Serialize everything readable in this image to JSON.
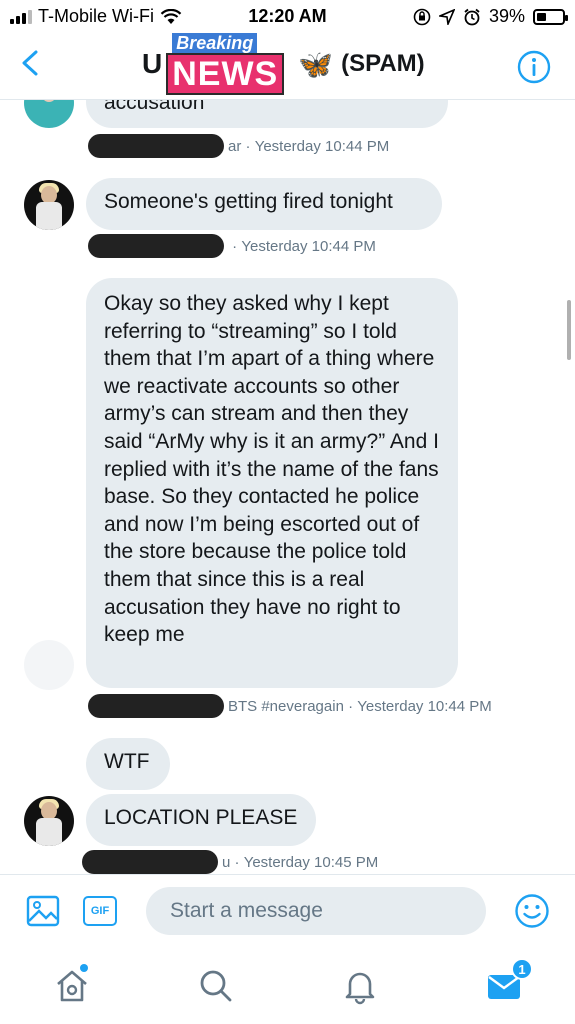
{
  "status_bar": {
    "carrier": "T-Mobile Wi-Fi",
    "time": "12:20 AM",
    "battery": "39%",
    "battery_level": 0.39
  },
  "header": {
    "title_lead": "U",
    "logo_top_text": "Breaking",
    "logo_main_text": "NEWS",
    "butterfly_glyph": "🦋",
    "title_tag": "(SPAM)",
    "back_icon": "chevron-left-icon",
    "info_icon": "info-icon"
  },
  "messages": [
    {
      "text": "accusation",
      "meta_name_tail": "ar",
      "meta_time": "Yesterday 10:44 PM"
    },
    {
      "text": "Someone's getting fired tonight",
      "meta_name_tail": "",
      "meta_time": "Yesterday 10:44 PM"
    },
    {
      "text": "Okay so they asked why I kept referring to “streaming” so I told them that I’m apart of a thing where we reactivate accounts so other army’s can stream and then they said “ArMy why is it an army?” And I replied with it’s the name of the fans base. So they contacted he police and now I’m being escorted out of the store because the police told them that since this is a real accusation they have no right to keep me",
      "meta_name_tail": "BTS #neveragain",
      "meta_time": "Yesterday 10:44 PM"
    },
    {
      "text": "WTF",
      "meta_name_tail": "",
      "meta_time": ""
    },
    {
      "text": "LOCATION PLEASE",
      "meta_name_tail": "u",
      "meta_time": "Yesterday 10:45 PM"
    }
  ],
  "composer": {
    "placeholder": "Start a message",
    "gif_label": "GIF",
    "image_icon": "image-icon",
    "emoji_icon": "emoji-icon"
  },
  "tabbar": {
    "home_icon": "home-icon",
    "search_icon": "search-icon",
    "notifications_icon": "bell-icon",
    "messages_icon": "mail-icon",
    "messages_badge": "1",
    "accent": "#1da1f2"
  }
}
